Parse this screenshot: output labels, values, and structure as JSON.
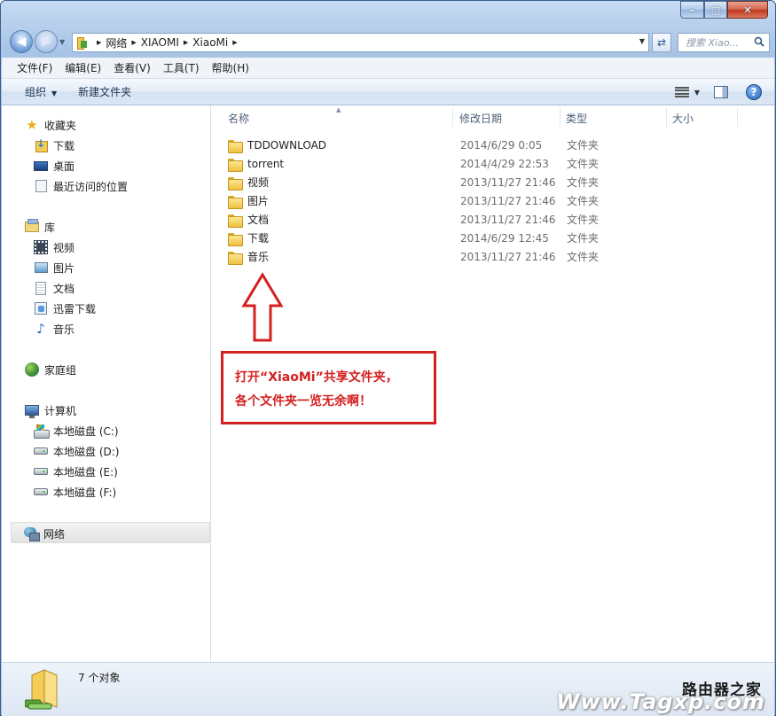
{
  "window": {
    "caption_min": "–",
    "caption_max": "□",
    "caption_close": "✕"
  },
  "address": {
    "crumbs": [
      "网络",
      "XIAOMI",
      "XiaoMi"
    ]
  },
  "search": {
    "placeholder": "搜索 Xiao..."
  },
  "menubar": {
    "items": [
      "文件(F)",
      "编辑(E)",
      "查看(V)",
      "工具(T)",
      "帮助(H)"
    ]
  },
  "toolbar": {
    "organize": "组织",
    "new_folder": "新建文件夹"
  },
  "navpane": {
    "favorites": {
      "label": "收藏夹",
      "items": [
        "下载",
        "桌面",
        "最近访问的位置"
      ]
    },
    "libraries": {
      "label": "库",
      "items": [
        "视频",
        "图片",
        "文档",
        "迅雷下载",
        "音乐"
      ]
    },
    "homegroup": "家庭组",
    "computer": {
      "label": "计算机",
      "items": [
        "本地磁盘 (C:)",
        "本地磁盘 (D:)",
        "本地磁盘 (E:)",
        "本地磁盘 (F:)"
      ]
    },
    "network": "网络"
  },
  "columns": {
    "name": "名称",
    "modified": "修改日期",
    "type": "类型",
    "size": "大小"
  },
  "files": [
    {
      "name": "TDDOWNLOAD",
      "date": "2014/6/29 0:05",
      "type": "文件夹"
    },
    {
      "name": "torrent",
      "date": "2014/4/29 22:53",
      "type": "文件夹"
    },
    {
      "name": "视频",
      "date": "2013/11/27 21:46",
      "type": "文件夹"
    },
    {
      "name": "图片",
      "date": "2013/11/27 21:46",
      "type": "文件夹"
    },
    {
      "name": "文档",
      "date": "2013/11/27 21:46",
      "type": "文件夹"
    },
    {
      "name": "下载",
      "date": "2014/6/29 12:45",
      "type": "文件夹"
    },
    {
      "name": "音乐",
      "date": "2013/11/27 21:46",
      "type": "文件夹"
    }
  ],
  "annotation": {
    "line1": "打开“XiaoMi”共享文件夹，",
    "line2": "各个文件夹一览无余啊！",
    "color": "#d42020"
  },
  "status": {
    "count": "7 个对象"
  },
  "watermark": {
    "cn": "路由器之家",
    "url": "Www.Tagxp.com"
  }
}
